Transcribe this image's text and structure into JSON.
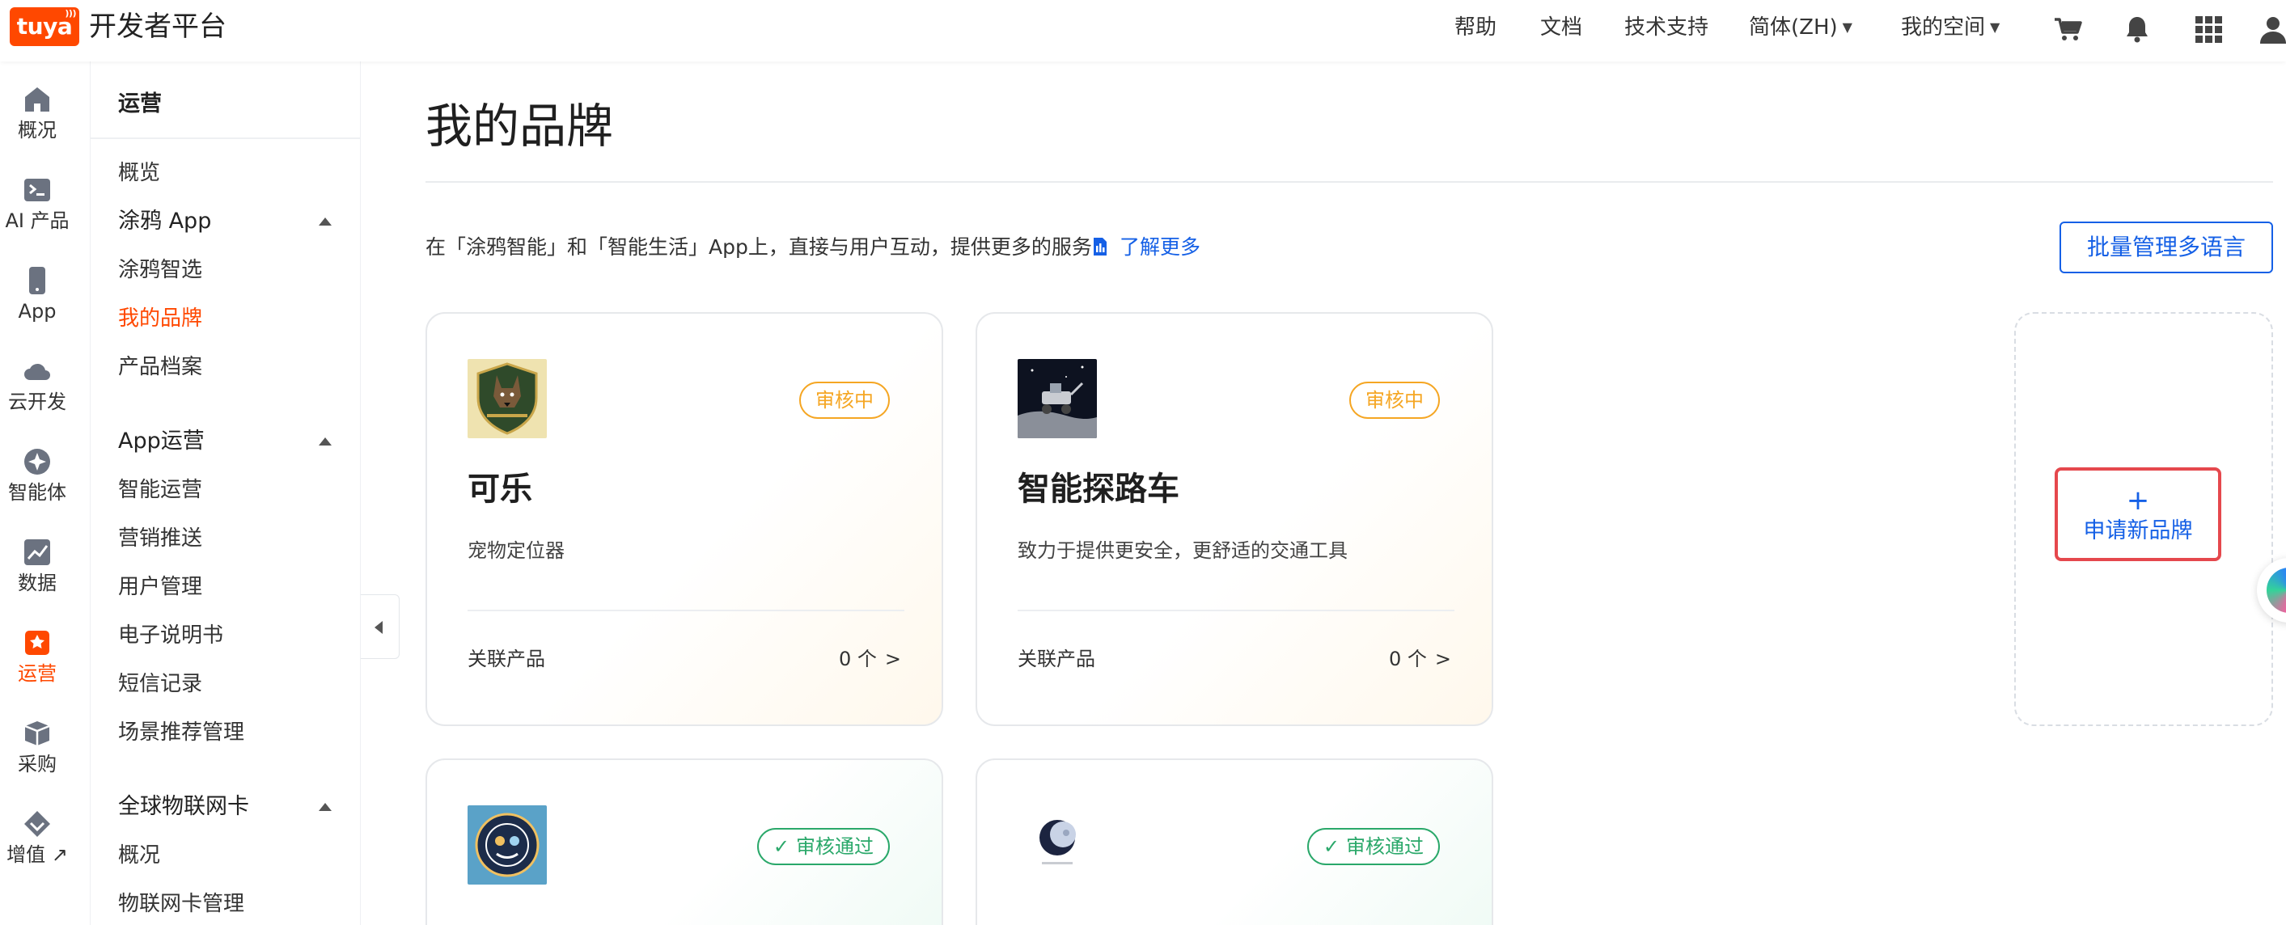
{
  "topbar": {
    "logo_text": "tuya",
    "platform_name": "开发者平台",
    "nav": [
      {
        "label": "帮助",
        "caret": false
      },
      {
        "label": "文档",
        "caret": false
      },
      {
        "label": "技术支持",
        "caret": false
      },
      {
        "label": "简体(ZH)",
        "caret": true
      },
      {
        "label": "我的空间",
        "caret": true
      }
    ],
    "icons": [
      "cart-icon",
      "bell-icon",
      "app-grid-icon",
      "user-icon"
    ]
  },
  "rail": {
    "items": [
      {
        "label": "概况",
        "icon": "home-icon",
        "active": false
      },
      {
        "label": "AI 产品",
        "icon": "terminal-icon",
        "active": false
      },
      {
        "label": "App",
        "icon": "phone-icon",
        "active": false
      },
      {
        "label": "云开发",
        "icon": "cloud-icon",
        "active": false
      },
      {
        "label": "智能体",
        "icon": "sparkle-icon",
        "active": false
      },
      {
        "label": "数据",
        "icon": "chart-icon",
        "active": false
      },
      {
        "label": "运营",
        "icon": "star-bag-icon",
        "active": true
      },
      {
        "label": "采购",
        "icon": "box-icon",
        "active": false
      },
      {
        "label": "增值 ↗",
        "icon": "diamond-icon",
        "active": false
      }
    ]
  },
  "subnav": {
    "title": "运营",
    "items": [
      {
        "label": "概览",
        "type": "item"
      },
      {
        "label": "涂鸦 App",
        "type": "group"
      },
      {
        "label": "涂鸦智选",
        "type": "item"
      },
      {
        "label": "我的品牌",
        "type": "item",
        "active": true
      },
      {
        "label": "产品档案",
        "type": "item"
      },
      {
        "label": "App运营",
        "type": "group"
      },
      {
        "label": "智能运营",
        "type": "item"
      },
      {
        "label": "营销推送",
        "type": "item"
      },
      {
        "label": "用户管理",
        "type": "item"
      },
      {
        "label": "电子说明书",
        "type": "item"
      },
      {
        "label": "短信记录",
        "type": "item"
      },
      {
        "label": "场景推荐管理",
        "type": "item"
      },
      {
        "label": "全球物联网卡",
        "type": "group"
      },
      {
        "label": "概况",
        "type": "item"
      },
      {
        "label": "物联网卡管理",
        "type": "item"
      }
    ]
  },
  "main": {
    "title": "我的品牌",
    "intro": "在「涂鸦智能」和「智能生活」App上，直接与用户互动，提供更多的服务",
    "learn_more": "了解更多",
    "batch_button": "批量管理多语言",
    "apply_button": "申请新品牌",
    "apply_plus": "+",
    "cards": [
      {
        "name": "可乐",
        "desc": "宠物定位器",
        "status": "审核中",
        "footer_label": "关联产品",
        "count": "0 个",
        "logo": "dog-shield-logo"
      },
      {
        "name": "智能探路车",
        "desc": "致力于提供更安全，更舒适的交通工具",
        "status": "审核中",
        "footer_label": "关联产品",
        "count": "0 个",
        "logo": "moon-rover-logo"
      },
      {
        "name": "",
        "desc": "",
        "status": "审核通过",
        "footer_label": "",
        "count": "",
        "logo": "circle-emblem-logo"
      },
      {
        "name": "",
        "desc": "",
        "status": "审核通过",
        "footer_label": "",
        "count": "",
        "logo": "moon-emblem-logo"
      }
    ]
  },
  "colors": {
    "brand_orange": "#ff4800",
    "link_blue": "#1560e6",
    "pending_amber": "#f5a623",
    "approved_green": "#2aa86a",
    "highlight_red": "#e5484d"
  }
}
